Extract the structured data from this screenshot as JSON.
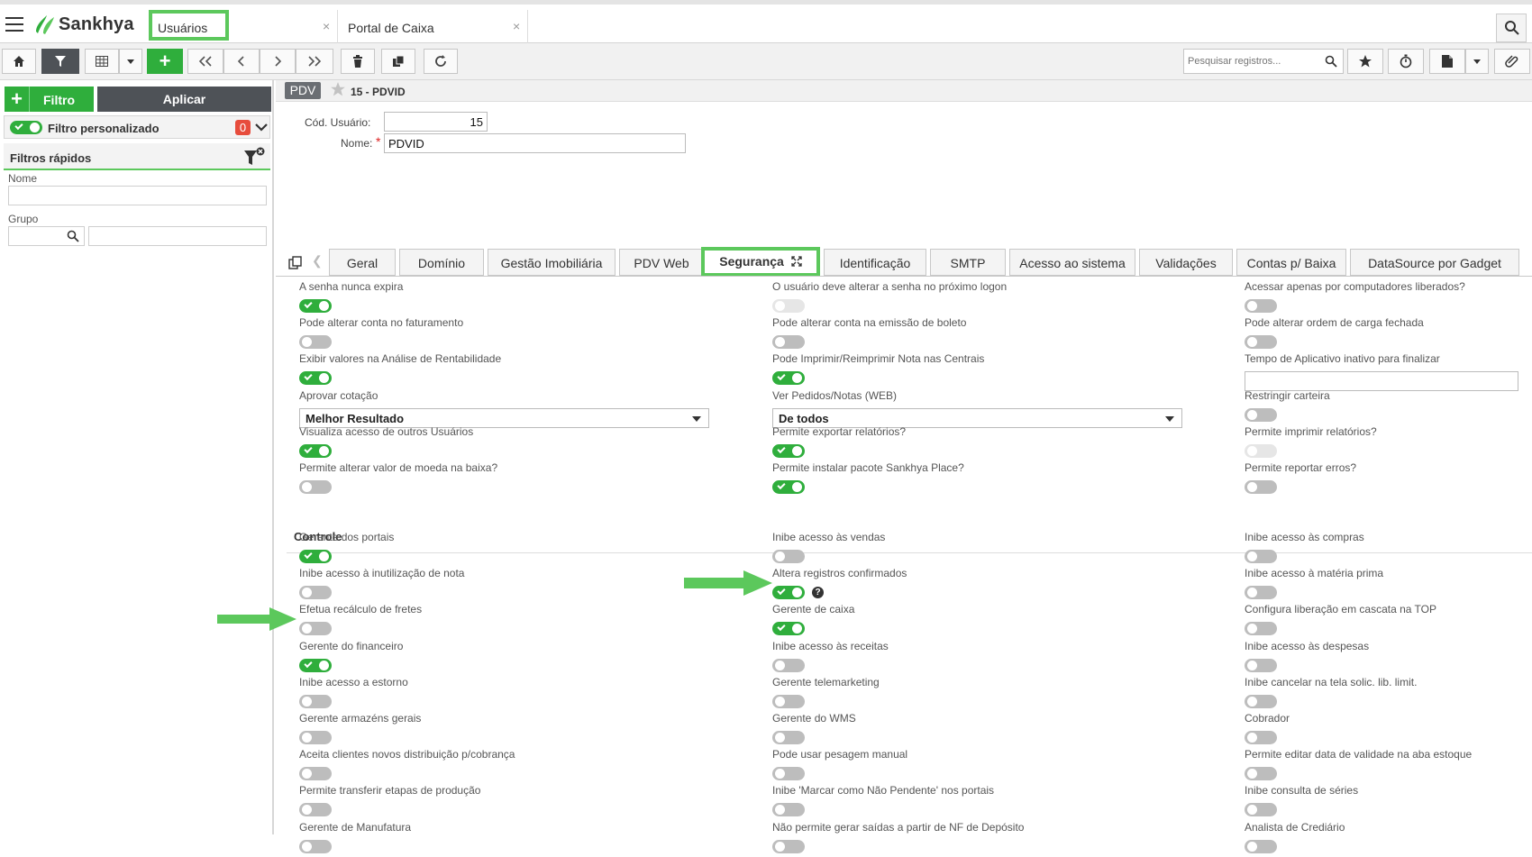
{
  "app": {
    "brand": "Sankhya",
    "brand_color": "#2fae3c"
  },
  "header": {
    "tabs": [
      {
        "label": "Usuários",
        "close": "×"
      },
      {
        "label": "Portal de Caixa",
        "close": "×"
      }
    ]
  },
  "toolbar": {
    "search_placeholder": "Pesquisar registros..."
  },
  "left_panel": {
    "filtro_label": "Filtro",
    "aplicar_label": "Aplicar",
    "filtro_personalizado_label": "Filtro personalizado",
    "filtro_count": "0",
    "filtros_rapidos_label": "Filtros rápidos",
    "nome_label": "Nome",
    "grupo_label": "Grupo"
  },
  "record": {
    "tag": "PDV",
    "title": "15 - PDVID",
    "cod_usuario_label": "Cód. Usuário:",
    "cod_usuario_value": "15",
    "nome_label": "Nome:",
    "nome_value": "PDVID"
  },
  "subtabs": [
    {
      "label": "Geral"
    },
    {
      "label": "Domínio"
    },
    {
      "label": "Gestão Imobiliária"
    },
    {
      "label": "PDV Web"
    },
    {
      "label": "Segurança"
    },
    {
      "label": "Identificação"
    },
    {
      "label": "SMTP"
    },
    {
      "label": "Acesso ao sistema"
    },
    {
      "label": "Validações"
    },
    {
      "label": "Contas p/ Baixa"
    },
    {
      "label": "DataSource por Gadget"
    }
  ],
  "security": {
    "col1": [
      {
        "label": "A senha nunca expira",
        "type": "toggle",
        "state": "on"
      },
      {
        "label": "Pode alterar conta no faturamento",
        "type": "toggle",
        "state": "off"
      },
      {
        "label": "Exibir valores na Análise de Rentabilidade",
        "type": "toggle",
        "state": "on"
      },
      {
        "label": "Aprovar cotação",
        "type": "select",
        "value": "Melhor Resultado"
      },
      {
        "label": "Visualiza acesso de outros Usuários",
        "type": "toggle",
        "state": "on"
      },
      {
        "label": "Permite alterar valor de moeda na baixa?",
        "type": "toggle",
        "state": "off"
      }
    ],
    "col2": [
      {
        "label": "O usuário deve alterar a senha no próximo logon",
        "type": "toggle",
        "state": "disabled"
      },
      {
        "label": "Pode alterar conta na emissão de boleto",
        "type": "toggle",
        "state": "off"
      },
      {
        "label": "Pode Imprimir/Reimprimir Nota nas Centrais",
        "type": "toggle",
        "state": "on"
      },
      {
        "label": "Ver Pedidos/Notas (WEB)",
        "type": "select",
        "value": "De todos"
      },
      {
        "label": "Permite exportar relatórios?",
        "type": "toggle",
        "state": "on"
      },
      {
        "label": "Permite instalar pacote Sankhya Place?",
        "type": "toggle",
        "state": "on"
      }
    ],
    "col3": [
      {
        "label": "Acessar apenas por computadores liberados?",
        "type": "toggle",
        "state": "off"
      },
      {
        "label": "Pode alterar ordem de carga fechada",
        "type": "toggle",
        "state": "off"
      },
      {
        "label": "Tempo de Aplicativo inativo para finalizar",
        "type": "input",
        "value": ""
      },
      {
        "label": "Restringir carteira",
        "type": "toggle",
        "state": "off"
      },
      {
        "label": "Permite imprimir relatórios?",
        "type": "toggle",
        "state": "disabled"
      },
      {
        "label": "Permite reportar erros?",
        "type": "toggle",
        "state": "off"
      }
    ]
  },
  "controle": {
    "title": "Controle",
    "col1": [
      {
        "label": "Gerente dos portais",
        "state": "on"
      },
      {
        "label": "Inibe acesso à inutilização de nota",
        "state": "off"
      },
      {
        "label": "Efetua recálculo de fretes",
        "state": "off"
      },
      {
        "label": "Gerente do financeiro",
        "state": "on"
      },
      {
        "label": "Inibe acesso a estorno",
        "state": "off"
      },
      {
        "label": "Gerente armazéns gerais",
        "state": "off"
      },
      {
        "label": "Aceita clientes novos distribuição p/cobrança",
        "state": "off"
      },
      {
        "label": "Permite transferir etapas de produção",
        "state": "off"
      },
      {
        "label": "Gerente de Manufatura",
        "state": "off"
      }
    ],
    "col2": [
      {
        "label": "Inibe acesso às vendas",
        "state": "off"
      },
      {
        "label": "Altera registros confirmados",
        "state": "on",
        "help": "?"
      },
      {
        "label": "Gerente de caixa",
        "state": "on"
      },
      {
        "label": "Inibe acesso às receitas",
        "state": "off"
      },
      {
        "label": "Gerente telemarketing",
        "state": "off"
      },
      {
        "label": "Gerente do WMS",
        "state": "off"
      },
      {
        "label": "Pode usar pesagem manual",
        "state": "off"
      },
      {
        "label": "Inibe 'Marcar como Não Pendente' nos portais",
        "state": "off"
      },
      {
        "label": "Não permite gerar saídas a partir de NF de Depósito",
        "state": "off"
      }
    ],
    "col3": [
      {
        "label": "Inibe acesso às compras",
        "state": "off"
      },
      {
        "label": "Inibe acesso à matéria prima",
        "state": "off"
      },
      {
        "label": "Configura liberação em cascata na TOP",
        "state": "off"
      },
      {
        "label": "Inibe acesso às despesas",
        "state": "off"
      },
      {
        "label": "Inibe cancelar na tela solic. lib. limit.",
        "state": "off"
      },
      {
        "label": "Cobrador",
        "state": "off"
      },
      {
        "label": "Permite editar data de validade na aba estoque",
        "state": "off"
      },
      {
        "label": "Inibe consulta de séries",
        "state": "off"
      },
      {
        "label": "Analista de Crediário",
        "state": "off"
      }
    ]
  },
  "colors": {
    "highlight": "#5cc85c",
    "toggle_on": "#2fae3c",
    "toggle_off": "#bdbdbd",
    "badge": "#e74c3c"
  }
}
